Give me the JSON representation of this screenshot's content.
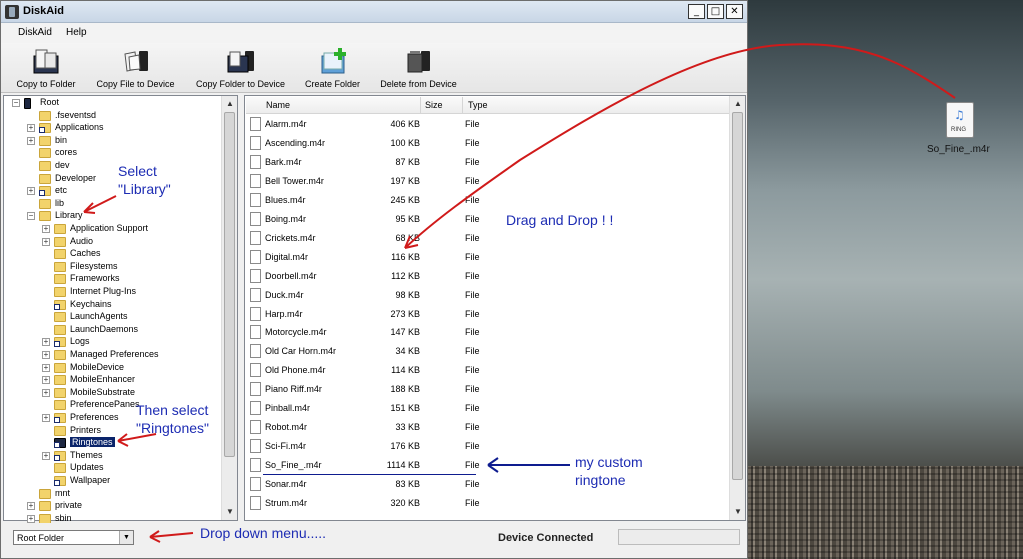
{
  "window": {
    "title": "DiskAid",
    "controls": [
      "_",
      "□",
      "✕"
    ]
  },
  "menubar": {
    "items": [
      "DiskAid",
      "Help"
    ]
  },
  "toolbar": {
    "buttons": [
      {
        "label": "Copy to Folder",
        "icon": "copy-to-folder-icon"
      },
      {
        "label": "Copy File to Device",
        "icon": "copy-file-to-device-icon"
      },
      {
        "label": "Copy Folder to Device",
        "icon": "copy-folder-to-device-icon"
      },
      {
        "label": "Create Folder",
        "icon": "create-folder-icon"
      },
      {
        "label": "Delete from Device",
        "icon": "delete-from-device-icon"
      }
    ]
  },
  "tree": {
    "items": [
      {
        "label": "Root",
        "depth": 0,
        "expander": "−",
        "icon": "device"
      },
      {
        "label": ".fseventsd",
        "depth": 1,
        "expander": "",
        "icon": "folder"
      },
      {
        "label": "Applications",
        "depth": 1,
        "expander": "+",
        "icon": "folder-link"
      },
      {
        "label": "bin",
        "depth": 1,
        "expander": "+",
        "icon": "folder"
      },
      {
        "label": "cores",
        "depth": 1,
        "expander": "",
        "icon": "folder"
      },
      {
        "label": "dev",
        "depth": 1,
        "expander": "",
        "icon": "folder"
      },
      {
        "label": "Developer",
        "depth": 1,
        "expander": "",
        "icon": "folder"
      },
      {
        "label": "etc",
        "depth": 1,
        "expander": "+",
        "icon": "folder-link"
      },
      {
        "label": "lib",
        "depth": 1,
        "expander": "",
        "icon": "folder"
      },
      {
        "label": "Library",
        "depth": 1,
        "expander": "−",
        "icon": "folder"
      },
      {
        "label": "Application Support",
        "depth": 2,
        "expander": "+",
        "icon": "folder"
      },
      {
        "label": "Audio",
        "depth": 2,
        "expander": "+",
        "icon": "folder"
      },
      {
        "label": "Caches",
        "depth": 2,
        "expander": "",
        "icon": "folder"
      },
      {
        "label": "Filesystems",
        "depth": 2,
        "expander": "",
        "icon": "folder"
      },
      {
        "label": "Frameworks",
        "depth": 2,
        "expander": "",
        "icon": "folder"
      },
      {
        "label": "Internet Plug-Ins",
        "depth": 2,
        "expander": "",
        "icon": "folder"
      },
      {
        "label": "Keychains",
        "depth": 2,
        "expander": "",
        "icon": "folder-link"
      },
      {
        "label": "LaunchAgents",
        "depth": 2,
        "expander": "",
        "icon": "folder"
      },
      {
        "label": "LaunchDaemons",
        "depth": 2,
        "expander": "",
        "icon": "folder"
      },
      {
        "label": "Logs",
        "depth": 2,
        "expander": "+",
        "icon": "folder-link"
      },
      {
        "label": "Managed Preferences",
        "depth": 2,
        "expander": "+",
        "icon": "folder"
      },
      {
        "label": "MobileDevice",
        "depth": 2,
        "expander": "+",
        "icon": "folder"
      },
      {
        "label": "MobileEnhancer",
        "depth": 2,
        "expander": "+",
        "icon": "folder"
      },
      {
        "label": "MobileSubstrate",
        "depth": 2,
        "expander": "+",
        "icon": "folder"
      },
      {
        "label": "PreferencePanes",
        "depth": 2,
        "expander": "",
        "icon": "folder"
      },
      {
        "label": "Preferences",
        "depth": 2,
        "expander": "+",
        "icon": "folder-link"
      },
      {
        "label": "Printers",
        "depth": 2,
        "expander": "",
        "icon": "folder"
      },
      {
        "label": "Ringtones",
        "depth": 2,
        "expander": "",
        "icon": "folder-dark",
        "selected": true
      },
      {
        "label": "Themes",
        "depth": 2,
        "expander": "+",
        "icon": "folder-link"
      },
      {
        "label": "Updates",
        "depth": 2,
        "expander": "",
        "icon": "folder"
      },
      {
        "label": "Wallpaper",
        "depth": 2,
        "expander": "",
        "icon": "folder-link"
      },
      {
        "label": "mnt",
        "depth": 1,
        "expander": "",
        "icon": "folder"
      },
      {
        "label": "private",
        "depth": 1,
        "expander": "+",
        "icon": "folder"
      },
      {
        "label": "sbin",
        "depth": 1,
        "expander": "+",
        "icon": "folder"
      }
    ]
  },
  "files": {
    "headers": {
      "name": "Name",
      "size": "Size",
      "type": "Type"
    },
    "rows": [
      {
        "name": "Alarm.m4r",
        "size": "406 KB",
        "type": "File"
      },
      {
        "name": "Ascending.m4r",
        "size": "100 KB",
        "type": "File"
      },
      {
        "name": "Bark.m4r",
        "size": "87 KB",
        "type": "File"
      },
      {
        "name": "Bell Tower.m4r",
        "size": "197 KB",
        "type": "File"
      },
      {
        "name": "Blues.m4r",
        "size": "245 KB",
        "type": "File"
      },
      {
        "name": "Boing.m4r",
        "size": "95 KB",
        "type": "File"
      },
      {
        "name": "Crickets.m4r",
        "size": "68 KB",
        "type": "File"
      },
      {
        "name": "Digital.m4r",
        "size": "116 KB",
        "type": "File"
      },
      {
        "name": "Doorbell.m4r",
        "size": "112 KB",
        "type": "File"
      },
      {
        "name": "Duck.m4r",
        "size": "98 KB",
        "type": "File"
      },
      {
        "name": "Harp.m4r",
        "size": "273 KB",
        "type": "File"
      },
      {
        "name": "Motorcycle.m4r",
        "size": "147 KB",
        "type": "File"
      },
      {
        "name": "Old Car Horn.m4r",
        "size": "34 KB",
        "type": "File"
      },
      {
        "name": "Old Phone.m4r",
        "size": "114 KB",
        "type": "File"
      },
      {
        "name": "Piano Riff.m4r",
        "size": "188 KB",
        "type": "File"
      },
      {
        "name": "Pinball.m4r",
        "size": "151 KB",
        "type": "File"
      },
      {
        "name": "Robot.m4r",
        "size": "33 KB",
        "type": "File"
      },
      {
        "name": "Sci-Fi.m4r",
        "size": "176 KB",
        "type": "File"
      },
      {
        "name": "So_Fine_.m4r",
        "size": "1114 KB",
        "type": "File"
      },
      {
        "name": "Sonar.m4r",
        "size": "83 KB",
        "type": "File"
      },
      {
        "name": "Strum.m4r",
        "size": "320 KB",
        "type": "File"
      }
    ]
  },
  "statusbar": {
    "folder_select": "Root Folder",
    "device_status": "Device Connected"
  },
  "annotations": {
    "select_library": "Select\n\"Library\"",
    "then_select": "Then select\n\"Ringtones\"",
    "drag_drop": "Drag and Drop ! !",
    "custom": "my custom\nringtone",
    "dropdown": "Drop down menu....."
  },
  "desktop": {
    "icon_label": "So_Fine_.m4r",
    "icon_badge": "RING",
    "icon_glyph": "♫"
  },
  "colors": {
    "annotation_text": "#1d2cb3",
    "annotation_arrow": "#d01a1a",
    "selection": "#0a246a",
    "blue_arrow": "#0e1c8f"
  }
}
